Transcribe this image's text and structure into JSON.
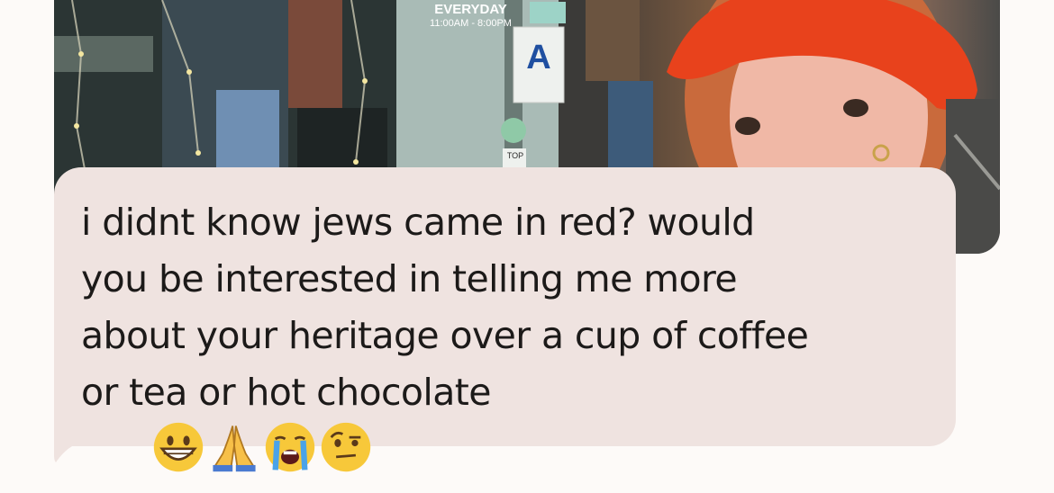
{
  "photo": {
    "sign_top": "EVERYDAY",
    "sign_hours": "11:00AM - 8:00PM",
    "grade_letter": "A",
    "sticker_text": "TOP"
  },
  "message": {
    "text": "i didnt know jews came in red? would\nyou be interested in telling me more\nabout your heritage over a cup of coffee\nor tea or hot chocolate",
    "emojis": [
      "grinning-face",
      "folded-hands",
      "loudly-crying-face",
      "face-with-raised-eyebrow"
    ]
  },
  "colors": {
    "background": "#fdfaf8",
    "bubble": "#efe3e0",
    "text": "#1c1a19",
    "beanie": "#e8421c"
  }
}
